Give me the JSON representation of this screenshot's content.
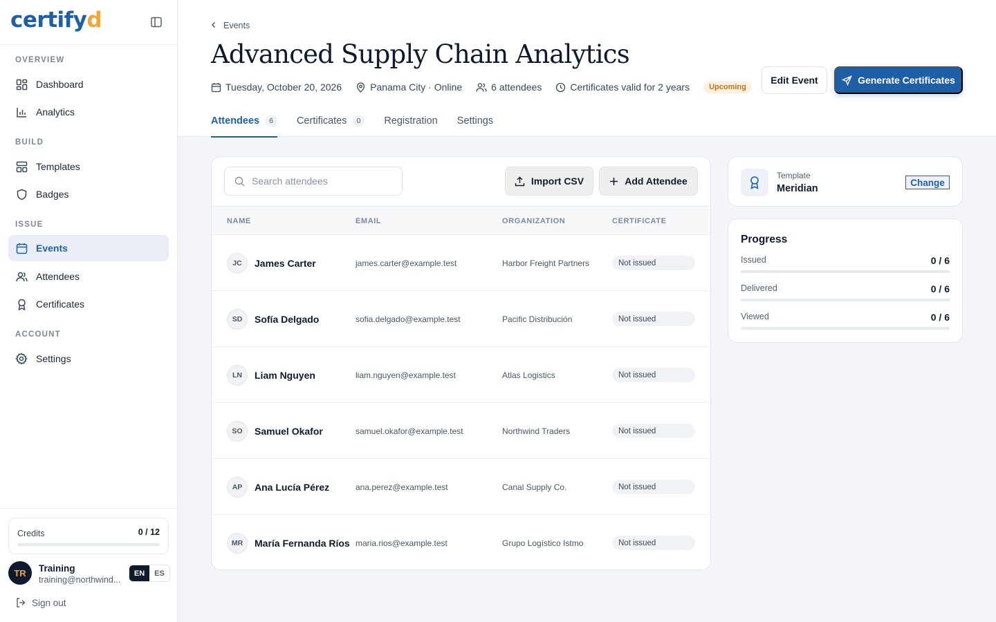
{
  "brand": {
    "logo_main": "certify",
    "logo_accent": "d"
  },
  "sidebar": {
    "sections": [
      {
        "label": "OVERVIEW"
      },
      {
        "label": "BUILD"
      },
      {
        "label": "ISSUE"
      },
      {
        "label": "ACCOUNT"
      }
    ],
    "items": [
      {
        "label": "Dashboard",
        "icon": "dashboard-icon"
      },
      {
        "label": "Analytics",
        "icon": "analytics-icon"
      },
      {
        "label": "Templates",
        "icon": "templates-icon"
      },
      {
        "label": "Badges",
        "icon": "badge-icon"
      },
      {
        "label": "Events",
        "icon": "calendar-icon",
        "active": true
      },
      {
        "label": "Attendees",
        "icon": "users-icon"
      },
      {
        "label": "Certificates",
        "icon": "award-icon"
      },
      {
        "label": "Settings",
        "icon": "gear-icon"
      }
    ],
    "credits": {
      "label": "Credits",
      "value": "0 / 12",
      "used_fraction": 0
    },
    "user": {
      "initials": "TR",
      "name": "Training",
      "email": "training@northwind..."
    },
    "lang": {
      "en": "EN",
      "es": "ES",
      "selected": "EN"
    },
    "signout_label": "Sign out"
  },
  "header": {
    "breadcrumb": "Events",
    "title": "Advanced Supply Chain Analytics",
    "date": "Tuesday, October 20, 2026",
    "location": "Panama City · Online",
    "attendees": "6 attendees",
    "validity": "Certificates valid for 2 years",
    "status": "Upcoming",
    "edit_label": "Edit Event",
    "generate_label": "Generate Certificates"
  },
  "tabs": [
    {
      "label": "Attendees",
      "count": "6",
      "active": true
    },
    {
      "label": "Certificates",
      "count": "0"
    },
    {
      "label": "Registration"
    },
    {
      "label": "Settings"
    }
  ],
  "toolbar": {
    "search_placeholder": "Search attendees",
    "import_label": "Import CSV",
    "add_label": "Add Attendee"
  },
  "table": {
    "columns": [
      "NAME",
      "EMAIL",
      "ORGANIZATION",
      "CERTIFICATE"
    ],
    "rows": [
      {
        "initials": "JC",
        "name": "James Carter",
        "email": "james.carter@example.test",
        "org": "Harbor Freight Partners",
        "status": "Not issued"
      },
      {
        "initials": "SD",
        "name": "Sofía Delgado",
        "email": "sofia.delgado@example.test",
        "org": "Pacific Distribución",
        "status": "Not issued"
      },
      {
        "initials": "LN",
        "name": "Liam Nguyen",
        "email": "liam.nguyen@example.test",
        "org": "Atlas Logistics",
        "status": "Not issued"
      },
      {
        "initials": "SO",
        "name": "Samuel Okafor",
        "email": "samuel.okafor@example.test",
        "org": "Northwind Traders",
        "status": "Not issued"
      },
      {
        "initials": "AP",
        "name": "Ana Lucía Pérez",
        "email": "ana.perez@example.test",
        "org": "Canal Supply Co.",
        "status": "Not issued"
      },
      {
        "initials": "MR",
        "name": "María Fernanda Ríos",
        "email": "maria.rios@example.test",
        "org": "Grupo Logístico Istmo",
        "status": "Not issued"
      }
    ]
  },
  "template_card": {
    "label": "Template",
    "name": "Meridian",
    "change_label": "Change"
  },
  "progress": {
    "title": "Progress",
    "items": [
      {
        "label": "Issued",
        "value": "0 / 6",
        "fraction": 0
      },
      {
        "label": "Delivered",
        "value": "0 / 6",
        "fraction": 0
      },
      {
        "label": "Viewed",
        "value": "0 / 6",
        "fraction": 0
      }
    ]
  },
  "colors": {
    "primary": "#1f5fa6",
    "accent": "#f0a63a",
    "ink": "#0f1b2d",
    "upcoming_bg": "#fdf0e0",
    "upcoming_text": "#c0731a"
  }
}
